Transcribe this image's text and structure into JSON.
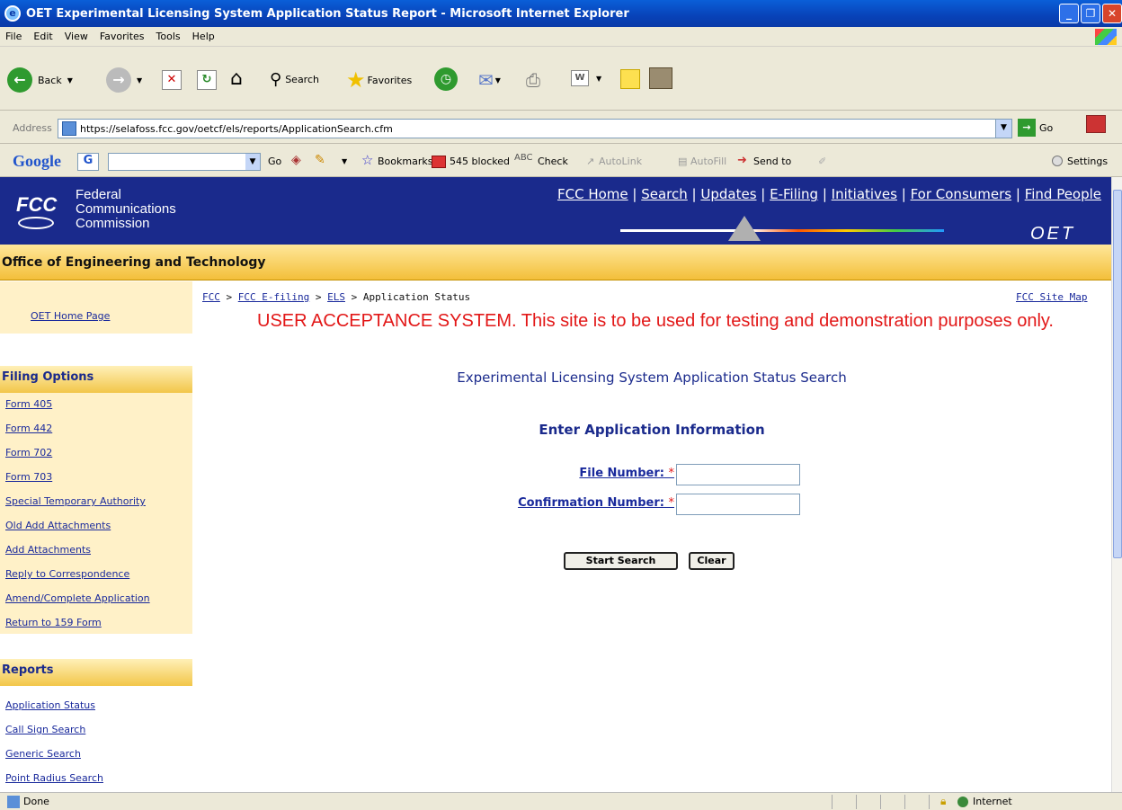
{
  "window": {
    "title": "OET Experimental Licensing System Application Status Report - Microsoft Internet Explorer"
  },
  "menu": [
    "File",
    "Edit",
    "View",
    "Favorites",
    "Tools",
    "Help"
  ],
  "toolbar": {
    "back": "Back",
    "search": "Search",
    "favorites": "Favorites"
  },
  "address": {
    "label": "Address",
    "url": "https://selafoss.fcc.gov/oetcf/els/reports/ApplicationSearch.cfm",
    "go": "Go"
  },
  "google": {
    "logo": "Google",
    "go": "Go",
    "bookmarks": "Bookmarks",
    "blocked": "545 blocked",
    "check": "Check",
    "autolink": "AutoLink",
    "autofill": "AutoFill",
    "sendto": "Send to",
    "settings": "Settings"
  },
  "header": {
    "org_line1": "Federal",
    "org_line2": "Communications",
    "org_line3": "Commission",
    "fcc": "FCC",
    "oet": "OET",
    "links": [
      "FCC Home",
      "Search",
      "Updates",
      "E-Filing",
      "Initiatives",
      "For Consumers",
      "Find People"
    ]
  },
  "office": "Office of Engineering and Technology",
  "sidebar": {
    "home": "OET Home Page",
    "filing_title": "Filing Options",
    "filing": [
      "Form 405",
      "Form 442",
      "Form 702",
      "Form 703",
      "Special Temporary Authority",
      "Old Add Attachments",
      "Add Attachments",
      "Reply to Correspondence",
      "Amend/Complete Application",
      "Return to 159 Form"
    ],
    "reports_title": "Reports",
    "reports": [
      "Application Status",
      "Call Sign Search",
      "Generic Search",
      "Point Radius Search"
    ]
  },
  "breadcrumb": {
    "fcc": "FCC",
    "efiling": "FCC E-filing",
    "els": "ELS",
    "current": "Application Status",
    "sep": ">"
  },
  "sitemap": "FCC Site Map",
  "warning": "USER ACCEPTANCE SYSTEM. This site is to be used for testing and demonstration purposes only.",
  "main": {
    "title": "Experimental Licensing System Application Status Search",
    "subtitle": "Enter Application Information",
    "file_label": "File Number:",
    "conf_label": "Confirmation Number:",
    "req": "*",
    "search_btn": "Start Search",
    "clear_btn": "Clear"
  },
  "status": {
    "text": "Done",
    "zone": "Internet"
  }
}
